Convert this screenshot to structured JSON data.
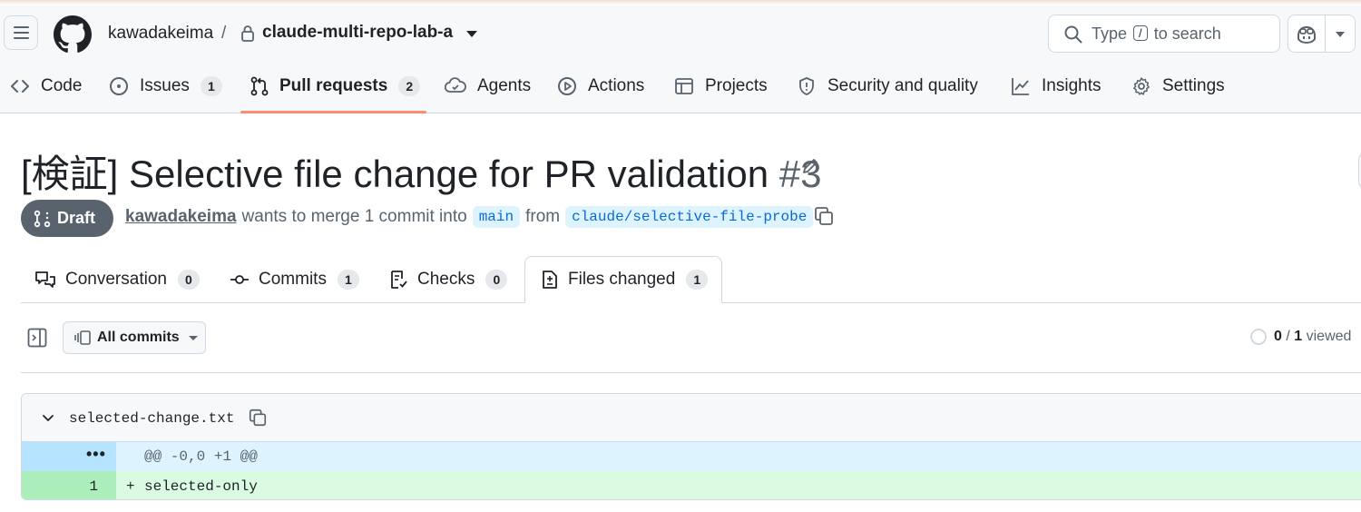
{
  "header": {
    "owner": "kawadakeima",
    "separator": "/",
    "repo": "claude-multi-repo-lab-a",
    "search": {
      "prefix": "Type",
      "key": "/",
      "suffix": "to search"
    }
  },
  "nav": {
    "code": "Code",
    "issues": {
      "label": "Issues",
      "count": "1"
    },
    "pulls": {
      "label": "Pull requests",
      "count": "2"
    },
    "agents": "Agents",
    "actions": "Actions",
    "projects": "Projects",
    "security": "Security and quality",
    "insights": "Insights",
    "settings": "Settings"
  },
  "pr": {
    "title": "[検証] Selective file change for PR validation",
    "number": "#3",
    "state": "Draft",
    "author": "kawadakeima",
    "merge_text": "wants to merge 1 commit into",
    "base": "main",
    "from_text": "from",
    "head": "claude/selective-file-probe"
  },
  "tabs": {
    "conversation": {
      "label": "Conversation",
      "count": "0"
    },
    "commits": {
      "label": "Commits",
      "count": "1"
    },
    "checks": {
      "label": "Checks",
      "count": "0"
    },
    "files": {
      "label": "Files changed",
      "count": "1"
    }
  },
  "toolbar": {
    "commits_filter": "All commits",
    "viewed_count": "0",
    "viewed_sep": "/",
    "viewed_total": "1",
    "viewed_label": "viewed"
  },
  "file": {
    "name": "selected-change.txt",
    "hunk_expand": "•••",
    "hunk_header": "@@ -0,0 +1 @@",
    "lines": [
      {
        "number": "1",
        "sign": "+",
        "text": "selected-only"
      }
    ]
  },
  "colors": {
    "accent_underline": "#fd8c73",
    "draft_badge": "#59636e",
    "branch_bg": "#ddf4ff",
    "addition_bg": "#dafbe1",
    "hunk_bg": "#ddf4ff"
  }
}
